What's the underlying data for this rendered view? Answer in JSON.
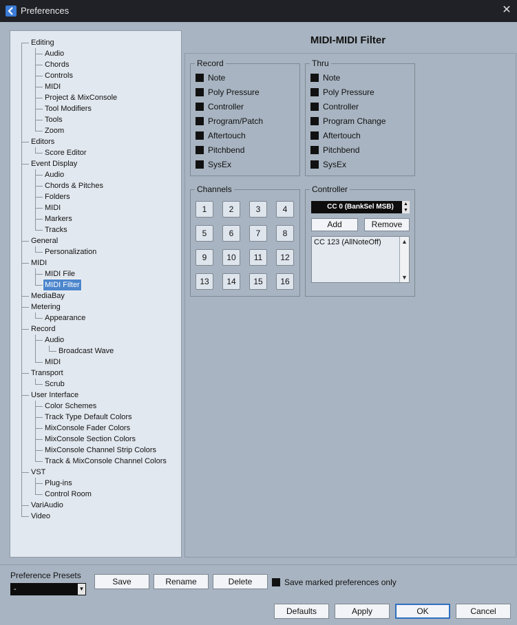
{
  "window": {
    "title": "Preferences",
    "close_glyph": "✕",
    "app_icon": "cubase-app-icon",
    "close_icon": "close-icon"
  },
  "tree": {
    "items": [
      {
        "label": "Editing",
        "level": 0
      },
      {
        "label": "Audio",
        "level": 1
      },
      {
        "label": "Chords",
        "level": 1
      },
      {
        "label": "Controls",
        "level": 1
      },
      {
        "label": "MIDI",
        "level": 1
      },
      {
        "label": "Project & MixConsole",
        "level": 1
      },
      {
        "label": "Tool Modifiers",
        "level": 1
      },
      {
        "label": "Tools",
        "level": 1
      },
      {
        "label": "Zoom",
        "level": 1
      },
      {
        "label": "Editors",
        "level": 0
      },
      {
        "label": "Score Editor",
        "level": 1
      },
      {
        "label": "Event Display",
        "level": 0
      },
      {
        "label": "Audio",
        "level": 1
      },
      {
        "label": "Chords & Pitches",
        "level": 1
      },
      {
        "label": "Folders",
        "level": 1
      },
      {
        "label": "MIDI",
        "level": 1
      },
      {
        "label": "Markers",
        "level": 1
      },
      {
        "label": "Tracks",
        "level": 1
      },
      {
        "label": "General",
        "level": 0
      },
      {
        "label": "Personalization",
        "level": 1
      },
      {
        "label": "MIDI",
        "level": 0
      },
      {
        "label": "MIDI File",
        "level": 1
      },
      {
        "label": "MIDI Filter",
        "level": 1,
        "selected": true
      },
      {
        "label": "MediaBay",
        "level": 0
      },
      {
        "label": "Metering",
        "level": 0
      },
      {
        "label": "Appearance",
        "level": 1
      },
      {
        "label": "Record",
        "level": 0
      },
      {
        "label": "Audio",
        "level": 1
      },
      {
        "label": "Broadcast Wave",
        "level": 2
      },
      {
        "label": "MIDI",
        "level": 1
      },
      {
        "label": "Transport",
        "level": 0
      },
      {
        "label": "Scrub",
        "level": 1
      },
      {
        "label": "User Interface",
        "level": 0
      },
      {
        "label": "Color Schemes",
        "level": 1
      },
      {
        "label": "Track Type Default Colors",
        "level": 1
      },
      {
        "label": "MixConsole Fader Colors",
        "level": 1
      },
      {
        "label": "MixConsole Section Colors",
        "level": 1
      },
      {
        "label": "MixConsole Channel Strip Colors",
        "level": 1
      },
      {
        "label": "Track & MixConsole Channel Colors",
        "level": 1
      },
      {
        "label": "VST",
        "level": 0
      },
      {
        "label": "Plug-ins",
        "level": 1
      },
      {
        "label": "Control Room",
        "level": 1
      },
      {
        "label": "VariAudio",
        "level": 0
      },
      {
        "label": "Video",
        "level": 0
      }
    ]
  },
  "page": {
    "title": "MIDI-MIDI Filter",
    "record": {
      "title": "Record",
      "items": [
        "Note",
        "Poly Pressure",
        "Controller",
        "Program/Patch",
        "Aftertouch",
        "Pitchbend",
        "SysEx"
      ]
    },
    "thru": {
      "title": "Thru",
      "items": [
        "Note",
        "Poly Pressure",
        "Controller",
        "Program Change",
        "Aftertouch",
        "Pitchbend",
        "SysEx"
      ]
    },
    "channels": {
      "title": "Channels",
      "buttons": [
        "1",
        "2",
        "3",
        "4",
        "5",
        "6",
        "7",
        "8",
        "9",
        "10",
        "11",
        "12",
        "13",
        "14",
        "15",
        "16"
      ]
    },
    "controller": {
      "title": "Controller",
      "selected": "CC 0  (BankSel MSB)",
      "add_label": "Add",
      "remove_label": "Remove",
      "list": [
        "CC 123  (AllNoteOff)"
      ]
    }
  },
  "footer": {
    "presets_label": "Preference Presets",
    "presets_value": "-",
    "save_label": "Save",
    "rename_label": "Rename",
    "delete_label": "Delete",
    "save_marked_label": "Save marked preferences only",
    "defaults_label": "Defaults",
    "apply_label": "Apply",
    "ok_label": "OK",
    "cancel_label": "Cancel"
  },
  "colors": {
    "window_bg": "#a8b4c1",
    "titlebar_bg": "#1f2126",
    "tree_bg": "#e2e8ef",
    "selection": "#4c86cc"
  }
}
